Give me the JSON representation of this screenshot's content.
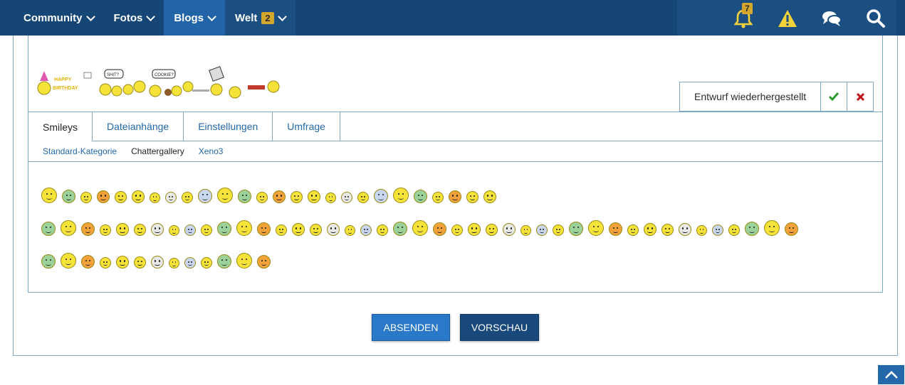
{
  "nav": {
    "items": [
      {
        "label": "Community"
      },
      {
        "label": "Fotos"
      },
      {
        "label": "Blogs"
      },
      {
        "label": "Welt",
        "badge": "2"
      }
    ],
    "notification_count": "7"
  },
  "editor": {
    "draft_status": "Entwurf wiederhergestellt"
  },
  "tabs": [
    "Smileys",
    "Dateianhänge",
    "Einstellungen",
    "Umfrage"
  ],
  "subtabs": [
    "Standard-Kategorie",
    "Chattergallery",
    "Xeno3"
  ],
  "smileys": {
    "row1_count": 26,
    "row2_count": 43,
    "row3_count": 13
  },
  "buttons": {
    "submit": "ABSENDEN",
    "preview": "VORSCHAU"
  },
  "colors": {
    "nav_bg": "#164675",
    "nav_active": "#2164a8",
    "badge": "#d4a72c",
    "link": "#2368a8",
    "submit_bg": "#2a78c8",
    "preview_bg": "#18497a",
    "confirm": "#2a9a2a",
    "cancel": "#c0141b"
  }
}
